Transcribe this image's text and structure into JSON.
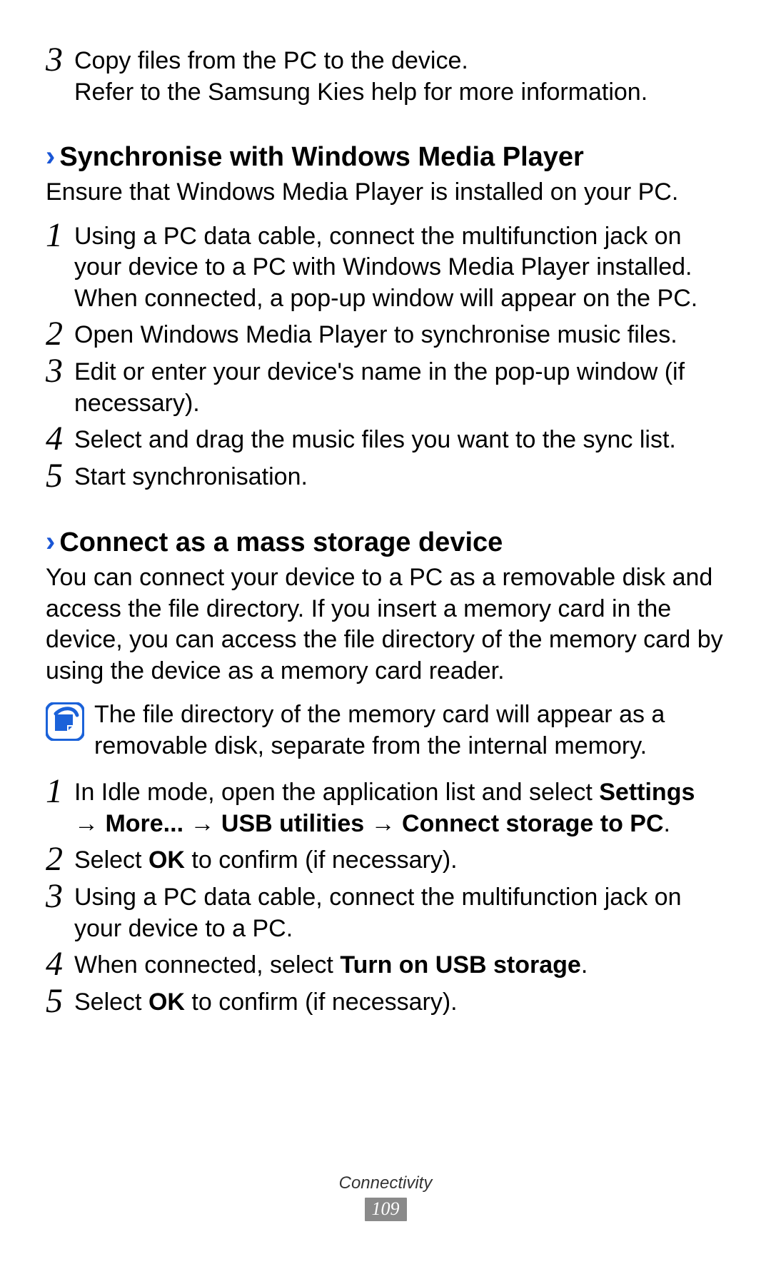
{
  "top_list": {
    "items": [
      {
        "num": "3",
        "lines": [
          "Copy files from the PC to the device.",
          "Refer to the Samsung Kies help for more information."
        ]
      }
    ]
  },
  "section1": {
    "heading": "Synchronise with Windows Media Player",
    "intro": "Ensure that Windows Media Player is installed on your PC.",
    "items": [
      {
        "num": "1",
        "text": "Using a PC data cable, connect the multifunction jack on your device to a PC with Windows Media Player installed. When connected, a pop-up window will appear on the PC."
      },
      {
        "num": "2",
        "text": "Open Windows Media Player to synchronise music files."
      },
      {
        "num": "3",
        "text": "Edit or enter your device's name in the pop-up window (if necessary)."
      },
      {
        "num": "4",
        "text": "Select and drag the music files you want to the sync list."
      },
      {
        "num": "5",
        "text": "Start synchronisation."
      }
    ]
  },
  "section2": {
    "heading": "Connect as a mass storage device",
    "intro": "You can connect your device to a PC as a removable disk and access the file directory. If you insert a memory card in the device, you can access the file directory of the memory card by using the device as a memory card reader.",
    "note": "The file directory of the memory card will appear as a removable disk, separate from the internal memory.",
    "items": [
      {
        "num": "1",
        "runs": [
          {
            "t": "In Idle mode, open the application list and select ",
            "b": false
          },
          {
            "t": "Settings → More... → USB utilities → Connect storage to PC",
            "b": true
          },
          {
            "t": ".",
            "b": false
          }
        ]
      },
      {
        "num": "2",
        "runs": [
          {
            "t": "Select ",
            "b": false
          },
          {
            "t": "OK",
            "b": true
          },
          {
            "t": " to confirm (if necessary).",
            "b": false
          }
        ]
      },
      {
        "num": "3",
        "runs": [
          {
            "t": "Using a PC data cable, connect the multifunction jack on your device to a PC.",
            "b": false
          }
        ]
      },
      {
        "num": "4",
        "runs": [
          {
            "t": "When connected, select ",
            "b": false
          },
          {
            "t": "Turn on USB storage",
            "b": true
          },
          {
            "t": ".",
            "b": false
          }
        ]
      },
      {
        "num": "5",
        "runs": [
          {
            "t": "Select ",
            "b": false
          },
          {
            "t": "OK",
            "b": true
          },
          {
            "t": " to confirm (if necessary).",
            "b": false
          }
        ]
      }
    ]
  },
  "footer": {
    "section_label": "Connectivity",
    "page_number": "109"
  },
  "icons": {
    "chevron": "›",
    "note_alt": "note-icon"
  }
}
